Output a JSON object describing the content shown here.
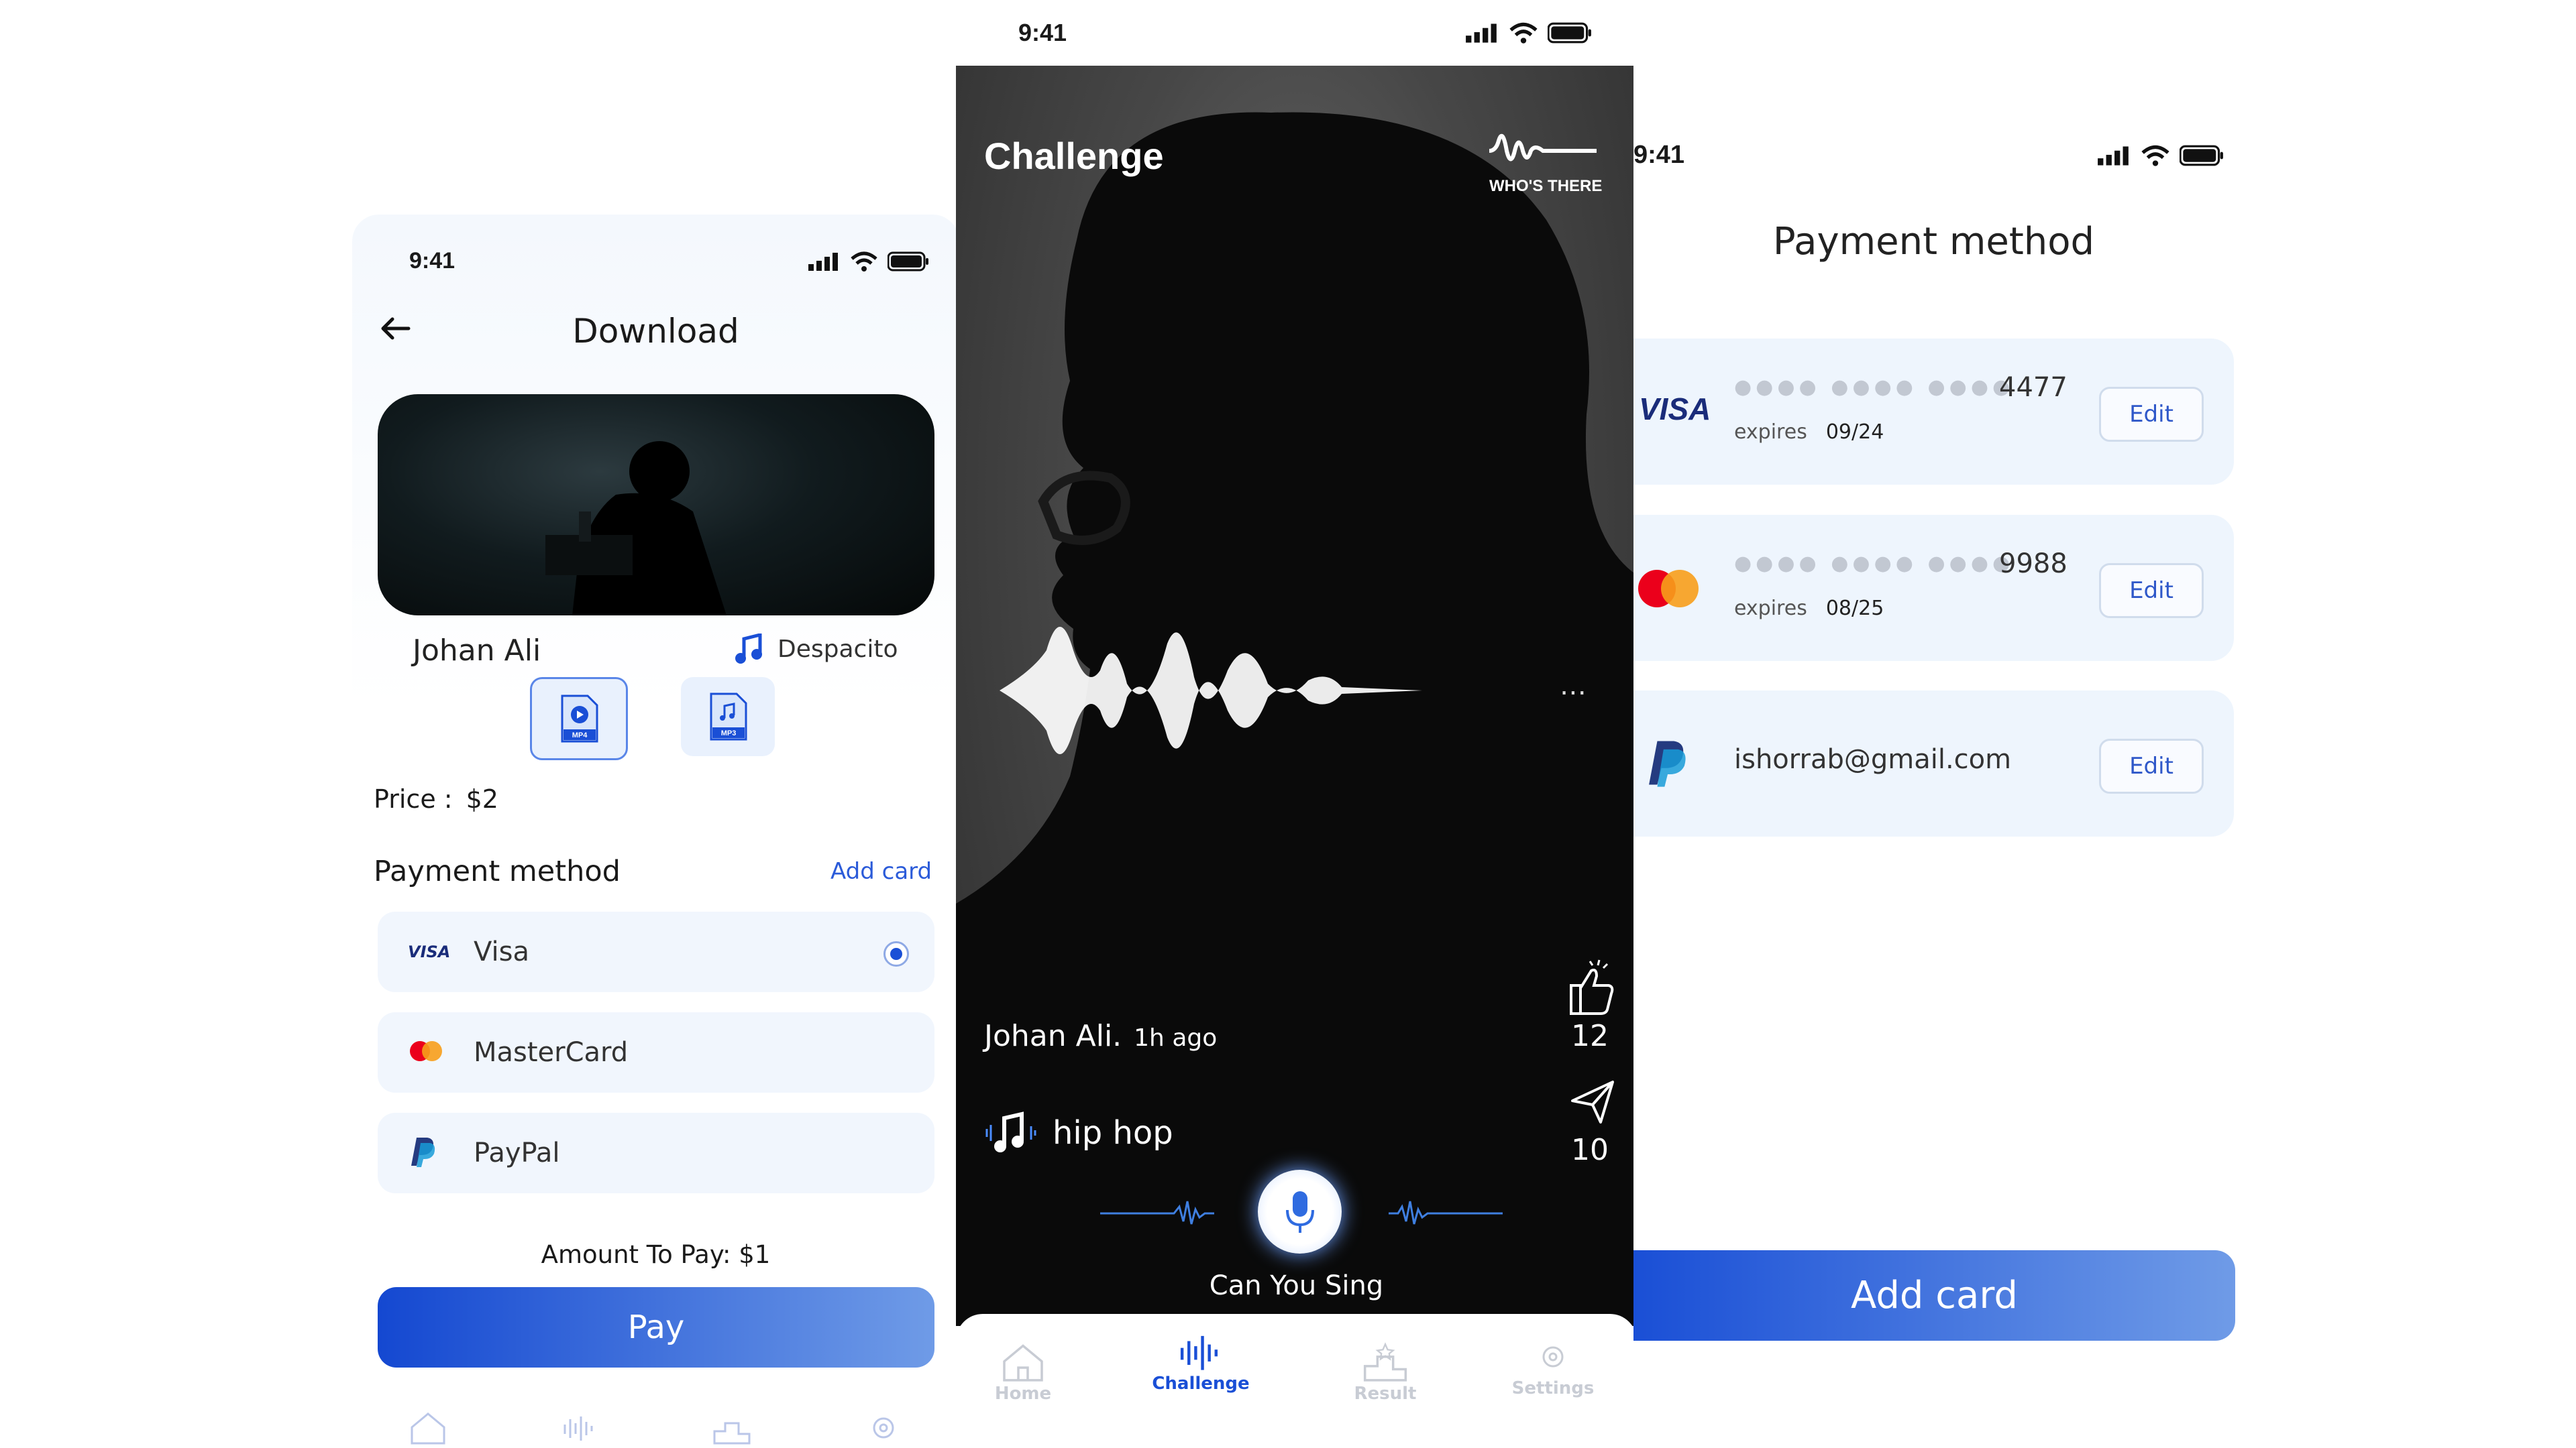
{
  "download_screen": {
    "status_time": "9:41",
    "title": "Download",
    "singer": "Johan Ali",
    "song": "Despacito",
    "formats": [
      "MP4",
      "MP3"
    ],
    "price_label": "Price :",
    "price_value": "$2",
    "payment_title": "Payment method",
    "add_card_link": "Add card",
    "methods": [
      {
        "icon_text": "VISA",
        "label": "Visa",
        "selected": true
      },
      {
        "label": "MasterCard"
      },
      {
        "label": "PayPal"
      }
    ],
    "amount_text": "Amount To Pay: $1",
    "pay_button": "Pay",
    "accent": "#1a4fd6"
  },
  "challenge_screen": {
    "status_time": "9:41",
    "title": "Challenge",
    "brand_logo_text": "WHO'S THERE",
    "more_icon": "more-dots-icon",
    "author": "Johan Ali.",
    "time_ago": "1h ago",
    "genre": "hip hop",
    "likes": "12",
    "shares": "10",
    "mic_caption": "Can You Sing",
    "nav": [
      {
        "label": "Home",
        "icon": "home-icon",
        "active": false
      },
      {
        "label": "Challenge",
        "icon": "waveform-icon",
        "active": true
      },
      {
        "label": "Result",
        "icon": "podium-icon",
        "active": false
      },
      {
        "label": "Settings",
        "icon": "gear-icon",
        "active": false
      }
    ]
  },
  "payment_screen": {
    "status_time": "9:41",
    "title": "Payment method",
    "cards": [
      {
        "brand": "VISA",
        "masked": "●●●● ●●●● ●●●●",
        "last4": "4477",
        "expires_label": "expires",
        "expires": "09/24",
        "edit": "Edit"
      },
      {
        "brand": "mastercard",
        "masked": "●●●● ●●●● ●●●●",
        "last4": "9988",
        "expires_label": "expires",
        "expires": "08/25",
        "edit": "Edit"
      },
      {
        "brand": "paypal",
        "email": "ishorrab@gmail.com",
        "edit": "Edit"
      }
    ],
    "add_card_button": "Add card"
  }
}
